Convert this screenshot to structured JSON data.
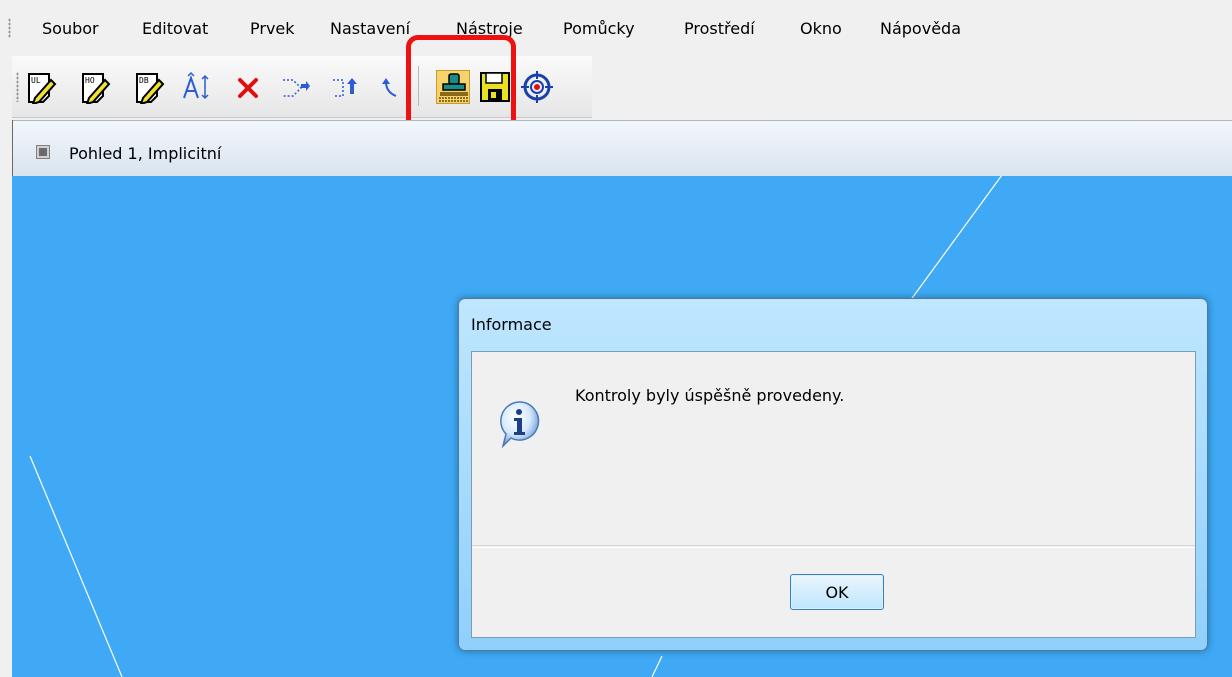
{
  "menu": {
    "items": [
      {
        "label": "Soubor"
      },
      {
        "label": "Editovat"
      },
      {
        "label": "Prvek"
      },
      {
        "label": "Nastavení"
      },
      {
        "label": "Nástroje"
      },
      {
        "label": "Pomůcky"
      },
      {
        "label": "Prostředí"
      },
      {
        "label": "Okno"
      },
      {
        "label": "Nápověda"
      }
    ]
  },
  "toolbar": {
    "buttons": [
      {
        "icon": "edit-ul-icon",
        "badge": "UL"
      },
      {
        "icon": "edit-ho-icon",
        "badge": "HO"
      },
      {
        "icon": "edit-db-icon",
        "badge": "DB"
      },
      {
        "icon": "text-size-icon"
      },
      {
        "icon": "delete-icon"
      },
      {
        "icon": "move-right-icon"
      },
      {
        "icon": "move-up-icon"
      },
      {
        "icon": "undo-arrow-icon"
      },
      {
        "icon": "stamp-icon",
        "active": true
      },
      {
        "icon": "save-disk-icon"
      },
      {
        "icon": "target-icon"
      }
    ]
  },
  "view": {
    "title": "Pohled 1, Implicitní",
    "background_color": "#3fa9f5"
  },
  "dialog": {
    "title": "Informace",
    "icon": "info-icon",
    "message": "Kontroly byly úspěšně provedeny.",
    "ok_label": "OK"
  },
  "colors": {
    "highlight": "#ee1111",
    "active_button": "#f6d46b"
  }
}
